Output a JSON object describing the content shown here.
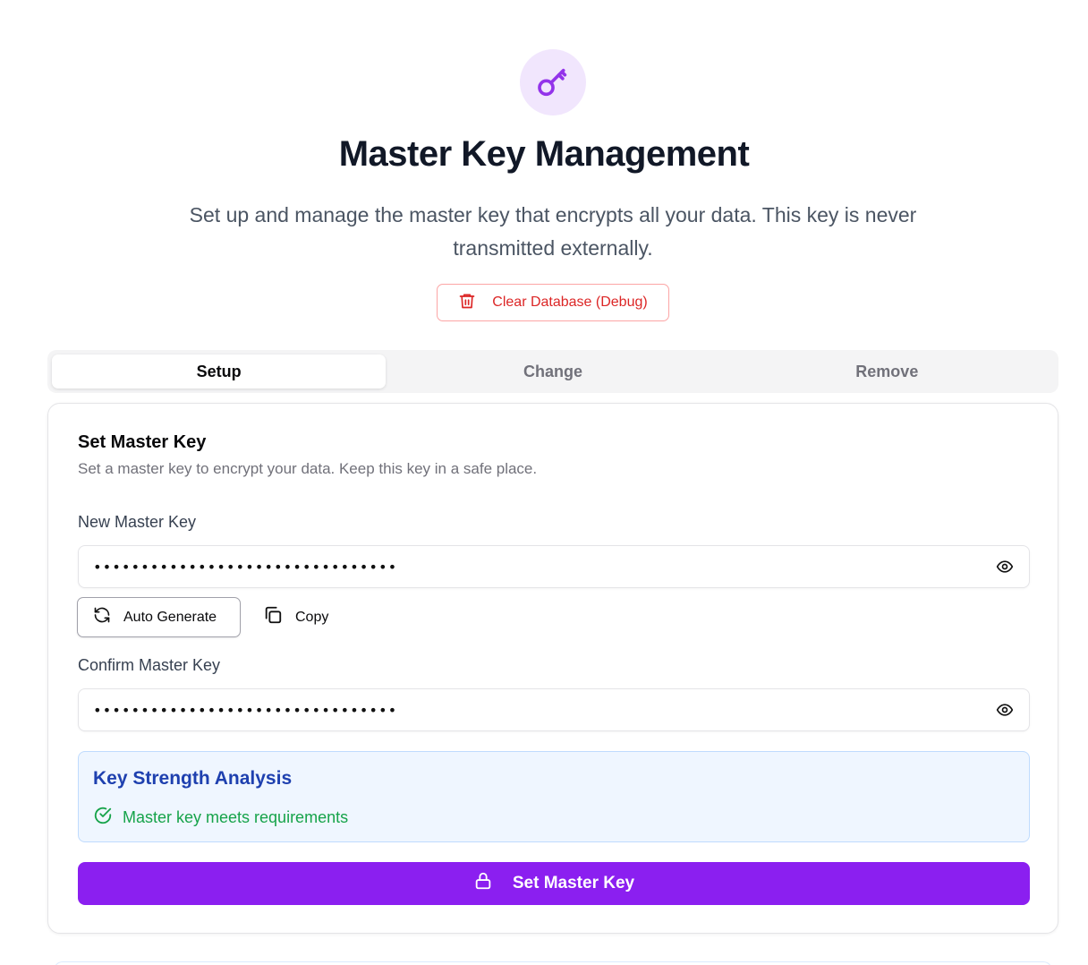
{
  "header": {
    "icon": "key-icon",
    "title": "Master Key Management",
    "subtitle": "Set up and manage the master key that encrypts all your data. This key is never transmitted externally.",
    "debug_button": {
      "label": "Clear Database (Debug)",
      "icon": "trash-icon",
      "color": "#dc2626"
    }
  },
  "tabs": [
    {
      "label": "Setup",
      "active": true
    },
    {
      "label": "Change",
      "active": false
    },
    {
      "label": "Remove",
      "active": false
    }
  ],
  "card": {
    "title": "Set Master Key",
    "description": "Set a master key to encrypt your data. Keep this key in a safe place.",
    "new_key": {
      "label": "New Master Key",
      "value": "••••••••••••••••••••••••••••••••",
      "icon": "eye-icon"
    },
    "auto_generate_label": "Auto Generate",
    "copy_label": "Copy",
    "confirm_key": {
      "label": "Confirm Master Key",
      "value": "••••••••••••••••••••••••••••••••",
      "icon": "eye-icon"
    },
    "strength": {
      "title": "Key Strength Analysis",
      "status": "Master key meets requirements",
      "status_color": "#16a34a"
    },
    "submit_label": "Set Master Key",
    "accent_color": "#8b1ff0"
  }
}
